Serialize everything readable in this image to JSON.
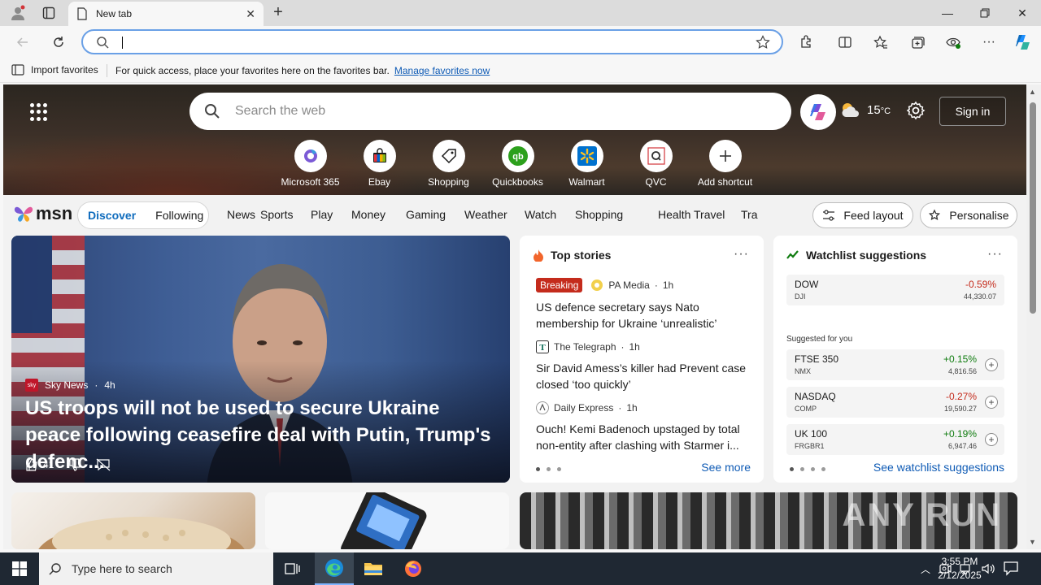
{
  "browser": {
    "tab_title": "New tab",
    "address_value": "",
    "favbar": {
      "import_label": "Import favorites",
      "message": "For quick access, place your favorites here on the favorites bar.",
      "manage_link": "Manage favorites now"
    }
  },
  "hero": {
    "search_placeholder": "Search the web",
    "weather_temp": "15",
    "weather_unit": "°C",
    "signin_label": "Sign in",
    "shortcuts": [
      {
        "label": "Microsoft 365",
        "icon": "microsoft-365-icon"
      },
      {
        "label": "Ebay",
        "icon": "ebay-icon"
      },
      {
        "label": "Shopping",
        "icon": "shopping-tag-icon"
      },
      {
        "label": "Quickbooks",
        "icon": "quickbooks-icon"
      },
      {
        "label": "Walmart",
        "icon": "walmart-icon"
      },
      {
        "label": "QVC",
        "icon": "qvc-icon"
      },
      {
        "label": "Add shortcut",
        "icon": "plus-icon"
      }
    ]
  },
  "msn": {
    "logo_text": "msn",
    "discover": "Discover",
    "following": "Following",
    "categories": [
      "News",
      "Sports",
      "Play",
      "Money",
      "Gaming",
      "Weather",
      "Watch",
      "Shopping",
      "Health",
      "Travel",
      "Tra"
    ],
    "feed_layout": "Feed layout",
    "personalise": "Personalise"
  },
  "feature": {
    "source": "Sky News",
    "age": "4h",
    "title": "US troops will not be used to secure Ukraine peace following ceasefire deal with Putin, Trump's defenc...",
    "likes": "41"
  },
  "top_stories": {
    "header": "Top stories",
    "items": [
      {
        "badge": "Breaking",
        "source": "PA Media",
        "age": "1h",
        "title": "US defence secretary says Nato membership for Ukraine ‘unrealistic’"
      },
      {
        "badge": "",
        "source": "The Telegraph",
        "age": "1h",
        "title": "Sir David Amess’s killer had Prevent case closed ‘too quickly’"
      },
      {
        "badge": "",
        "source": "Daily Express",
        "age": "1h",
        "title": "Ouch! Kemi Badenoch upstaged by total non-entity after clashing with Starmer i..."
      }
    ],
    "see_more": "See more"
  },
  "watchlist": {
    "header": "Watchlist suggestions",
    "top": {
      "symbol": "DOW",
      "exchange": "DJI",
      "change": "-0.59%",
      "price": "44,330.07",
      "trend": "down"
    },
    "suggested_label": "Suggested for you",
    "items": [
      {
        "symbol": "FTSE 350",
        "exchange": "NMX",
        "change": "+0.15%",
        "price": "4,816.56",
        "trend": "up"
      },
      {
        "symbol": "NASDAQ",
        "exchange": "COMP",
        "change": "-0.27%",
        "price": "19,590.27",
        "trend": "down"
      },
      {
        "symbol": "UK 100",
        "exchange": "FRGBR1",
        "change": "+0.19%",
        "price": "6,947.46",
        "trend": "up"
      }
    ],
    "see_more": "See watchlist suggestions"
  },
  "watermark": "ANY RUN",
  "taskbar": {
    "search_placeholder": "Type here to search",
    "time": "3:55 PM",
    "date": "2/12/2025"
  },
  "colors": {
    "accent": "#0f6cbd",
    "negative": "#c42b1c",
    "positive": "#107c10",
    "taskbar": "#1f2833"
  }
}
